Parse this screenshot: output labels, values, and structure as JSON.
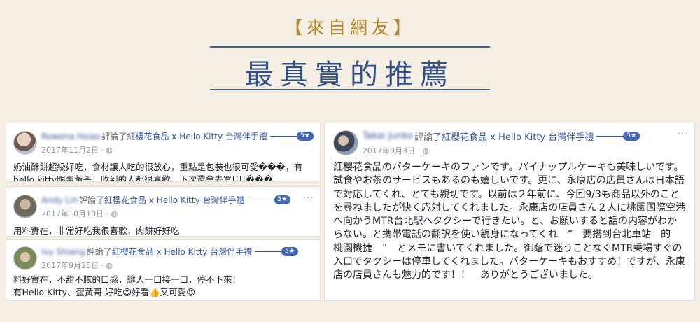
{
  "header": {
    "subtitle": "【來自網友】",
    "title": "最真實的推薦"
  },
  "reviews": [
    {
      "name": "Rowena Hsiao",
      "action": "評論了",
      "page": "紅櫻花食品 x Hello Kitty 台灣伴手禮",
      "rating": "5★",
      "date": "2017年11月2日 · ",
      "text": "奶油酥餅超級好吃，食材讓人吃的很放心，重點是包裝也很可愛���，有hello kitty跟蛋黃哥，收到的人都很喜歡，下次還會去買!!!!���"
    },
    {
      "name": "Andy Lin",
      "action": "評論了",
      "page": "紅櫻花食品 x Hello Kitty 台灣伴手禮",
      "rating": "5★",
      "date": "2017年10月10日 · ",
      "text": "用料實在，非常好吃我很喜歡，肉餅好好吃"
    },
    {
      "name": "Ivy Shiang",
      "action": "評論了",
      "page": "紅櫻花食品 x Hello Kitty 台灣伴手禮",
      "rating": "5★",
      "date": "2017年9月25日 · ",
      "text": "料好實在，不甜不膩的口感，讓人一口接一口，停不下來！\n有Hello Kitty、蛋黃哥 好吃😋好看👍又可愛😍"
    },
    {
      "name": "Takai Junko",
      "action": "評論了",
      "page": "紅櫻花食品 x Hello Kitty 台灣伴手禮",
      "rating": "5★",
      "date": "2017年9月3日 · ",
      "text": "紅櫻花食品のバターケーキのファンです。パイナップルケーキも美味しいです。試食やお茶のサービスもあるのも嬉しいです。更に、永康店の店員さんは日本語で対応してくれ、とても親切です。以前は２年前に、今回9/3も商品以外のことを尋ねましたが快く応対してくれました。永康店の店員さん２人に桃園国際空港へ向かうMTR台北駅へタクシーで行きたい。と、お願いすると話の内容がわからない。と携帯電話の翻訳を使い親身になってくれ　”　要搭到台北車站　的　桃園機捷　”　とメモに書いてくれました。御蔭で迷うことなくMTR乗場すぐの入口でタクシーは停車してくれました。バターケーキもおすすめ！ですが、永康店の店員さんも魅力的です！！　ありがとうございました。"
    }
  ],
  "ui": {
    "more_icon": "···"
  }
}
